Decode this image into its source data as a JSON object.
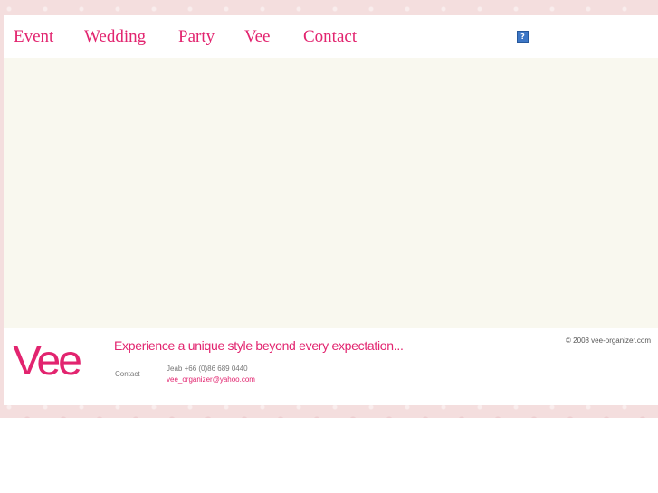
{
  "nav": {
    "items": [
      {
        "label": "Event"
      },
      {
        "label": "Wedding"
      },
      {
        "label": "Party"
      },
      {
        "label": "Vee"
      },
      {
        "label": "Contact"
      }
    ],
    "help_icon_glyph": "?"
  },
  "footer": {
    "logo": "Vee",
    "tagline": "Experience a unique style beyond every expectation...",
    "copyright": "© 2008 vee-organizer.com",
    "contact_label": "Contact",
    "contact_phone": "Jeab +66 (0)86 689 0440",
    "contact_email": "vee_organizer@yahoo.com"
  },
  "colors": {
    "accent": "#e2246f",
    "page_pattern": "#f4dede",
    "content_bg": "#f9f8ef"
  }
}
